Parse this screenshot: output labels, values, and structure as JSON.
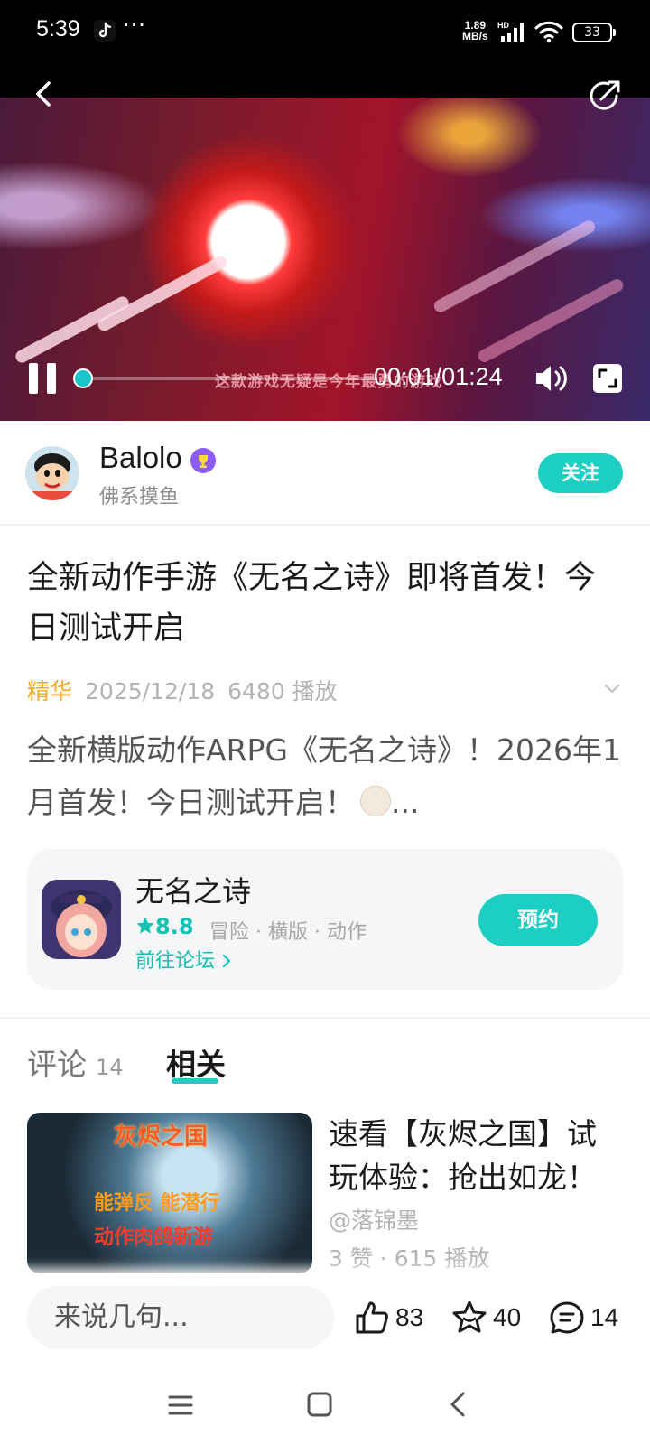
{
  "status_bar": {
    "time": "5:39",
    "dots": "···",
    "net_speed_value": "1.89",
    "net_speed_unit": "MB/s",
    "net_type": "HD",
    "battery": "33"
  },
  "video": {
    "subtitle": "这款游戏无疑是今年最勇的游戏",
    "timecode": "00:01/01:24",
    "progress_fraction": 0.012
  },
  "author": {
    "name": "Balolo",
    "subtitle": "佛系摸鱼",
    "follow_label": "关注"
  },
  "post": {
    "title": "全新动作手游《无名之诗》即将首发！今日测试开启",
    "tag": "精华",
    "date": "2025/12/18",
    "plays": "6480 播放",
    "description": "全新横版动作ARPG《无名之诗》！2026年1月首发！今日测试开启！"
  },
  "game_card": {
    "name": "无名之诗",
    "rating": "8.8",
    "tags": "冒险 · 横版 · 动作",
    "forum_link": "前往论坛",
    "reserve_label": "预约"
  },
  "tabs": {
    "comments_label": "评论",
    "comments_count": "14",
    "related_label": "相关"
  },
  "related": {
    "thumb_title": "灰烬之国",
    "thumb_line1": "能弹反 能潜行",
    "thumb_line2": "动作肉鸽新游",
    "title": "速看【灰烬之国】试玩体验：抢出如龙！",
    "author": "@落锦墨",
    "stats": "3 赞 · 615 播放"
  },
  "bottom_bar": {
    "input_placeholder": "来说几句...",
    "likes": "83",
    "favorites": "40",
    "comments": "14"
  },
  "colors": {
    "accent": "#1dcfc3",
    "tag": "#f5a623",
    "muted": "#b3b3b3"
  }
}
